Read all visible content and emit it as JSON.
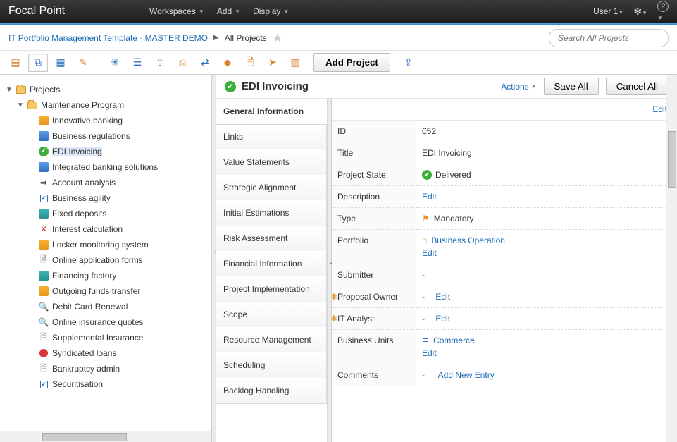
{
  "topbar": {
    "brand": "Focal Point",
    "menu": [
      "Workspaces",
      "Add",
      "Display"
    ],
    "user": "User 1"
  },
  "breadcrumb": {
    "root": "IT Portfolio Management Template - MASTER DEMO",
    "current": "All Projects"
  },
  "search": {
    "placeholder": "Search All Projects"
  },
  "toolbar": {
    "add_project": "Add Project"
  },
  "sidebar": {
    "root": "Projects",
    "group": "Maintenance Program",
    "items": [
      {
        "label": "Innovative banking",
        "icon": "orange"
      },
      {
        "label": "Business regulations",
        "icon": "blue"
      },
      {
        "label": "EDI Invoicing",
        "icon": "green",
        "selected": true
      },
      {
        "label": "Integrated banking solutions",
        "icon": "blue"
      },
      {
        "label": "Account analysis",
        "icon": "arrow"
      },
      {
        "label": "Business agility",
        "icon": "check"
      },
      {
        "label": "Fixed deposits",
        "icon": "teal"
      },
      {
        "label": "Interest calculation",
        "icon": "graph"
      },
      {
        "label": "Locker monitoring system",
        "icon": "orange"
      },
      {
        "label": "Online application forms",
        "icon": "doc"
      },
      {
        "label": "Financing factory",
        "icon": "teal"
      },
      {
        "label": "Outgoing funds transfer",
        "icon": "orange"
      },
      {
        "label": "Debit Card Renewal",
        "icon": "lens"
      },
      {
        "label": "Online insurance quotes",
        "icon": "lens"
      },
      {
        "label": "Supplemental Insurance",
        "icon": "doc"
      },
      {
        "label": "Syndicated loans",
        "icon": "stop"
      },
      {
        "label": "Bankruptcy admin",
        "icon": "doc"
      },
      {
        "label": "Securitisation",
        "icon": "check"
      }
    ]
  },
  "content": {
    "title": "EDI Invoicing",
    "actions_label": "Actions",
    "save_all": "Save All",
    "cancel_all": "Cancel All",
    "edit": "Edit",
    "nav": [
      "General Information",
      "Links",
      "Value Statements",
      "Strategic Alignment",
      "Initial Estimations",
      "Risk Assessment",
      "Financial Information",
      "Project Implementation",
      "Scope",
      "Resource Management",
      "Scheduling",
      "Backlog Handling"
    ],
    "fields": {
      "id_label": "ID",
      "id_val": "052",
      "title_label": "Title",
      "title_val": "EDI Invoicing",
      "state_label": "Project State",
      "state_val": "Delivered",
      "desc_label": "Description",
      "desc_edit": "Edit",
      "type_label": "Type",
      "type_val": "Mandatory",
      "portfolio_label": "Portfolio",
      "portfolio_val": "Business Operation",
      "portfolio_edit": "Edit",
      "submitter_label": "Submitter",
      "submitter_val": "-",
      "owner_label": "Proposal Owner",
      "owner_dash": "-",
      "owner_edit": "Edit",
      "analyst_label": "IT Analyst",
      "analyst_dash": "-",
      "analyst_edit": "Edit",
      "bunits_label": "Business Units",
      "bunits_val": "Commerce",
      "bunits_edit": "Edit",
      "comments_label": "Comments",
      "comments_dash": "-",
      "comments_add": "Add New Entry"
    }
  }
}
